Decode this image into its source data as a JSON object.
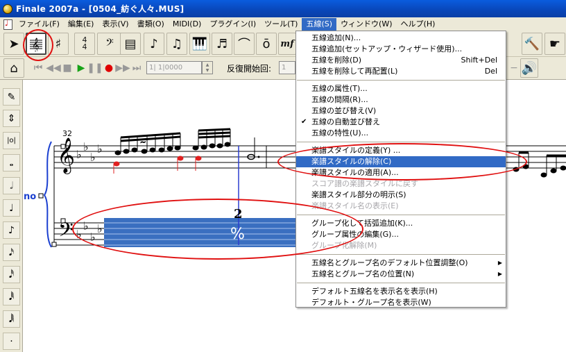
{
  "window": {
    "title": "Finale 2007a - [0504_紡ぐ人々.MUS]"
  },
  "menubar": {
    "items": [
      "ファイル(F)",
      "編集(E)",
      "表示(V)",
      "書類(O)",
      "MIDI(D)",
      "プラグイン(I)",
      "ツール(T)",
      "五線(S)",
      "ウィンドウ(W)",
      "ヘルプ(H)"
    ],
    "active": "五線(S)"
  },
  "playback": {
    "counter": "1| 1|0000",
    "repeat_label": "反復開始回:",
    "repeat_value": "1"
  },
  "score": {
    "measure_number": "32",
    "rest_count": "2",
    "staff_label": "no"
  },
  "dropdown": {
    "items": [
      {
        "label": "五線追加(N)...",
        "shortcut": ""
      },
      {
        "label": "五線追加(セットアップ・ウィザード使用)...",
        "shortcut": ""
      },
      {
        "label": "五線を削除(D)",
        "shortcut": "Shift+Del"
      },
      {
        "label": "五線を削除して再配置(L)",
        "shortcut": "Del"
      },
      {
        "separator": true
      },
      {
        "label": "五線の属性(T)...",
        "shortcut": ""
      },
      {
        "label": "五線の間隔(R)...",
        "shortcut": ""
      },
      {
        "label": "五線の並び替え(V)",
        "shortcut": ""
      },
      {
        "label": "五線の自動並び替え",
        "shortcut": "",
        "checked": true
      },
      {
        "label": "五線の特性(U)...",
        "shortcut": ""
      },
      {
        "separator": true
      },
      {
        "label": "楽譜スタイルの定義(Y) ...",
        "shortcut": ""
      },
      {
        "label": "楽譜スタイルの解除(C)",
        "shortcut": "",
        "highlighted": true
      },
      {
        "label": "楽譜スタイルの適用(A)...",
        "shortcut": ""
      },
      {
        "label": "スコア譜の楽譜スタイルに戻す",
        "shortcut": "",
        "disabled": true
      },
      {
        "label": "楽譜スタイル部分の明示(S)",
        "shortcut": ""
      },
      {
        "label": "楽譜スタイル名の表示(E)",
        "shortcut": "",
        "disabled": true
      },
      {
        "separator": true
      },
      {
        "label": "グループ化して括弧追加(K)...",
        "shortcut": ""
      },
      {
        "label": "グループ属性の編集(G)...",
        "shortcut": ""
      },
      {
        "label": "グループ化解除(M)",
        "shortcut": "",
        "disabled": true
      },
      {
        "separator": true
      },
      {
        "label": "五線名とグループ名のデフォルト位置調整(O)",
        "shortcut": "",
        "submenu": true
      },
      {
        "label": "五線名とグループ名の位置(N)",
        "shortcut": "",
        "submenu": true
      },
      {
        "separator": true
      },
      {
        "label": "デフォルト五線名を表示名を表示(H)",
        "shortcut": ""
      },
      {
        "label": "デフォルト・グループ名を表示(W)",
        "shortcut": ""
      }
    ]
  },
  "colors": {
    "titlebar": "#0a4fc9",
    "menu_highlight": "#316ac5",
    "annotation": "#e01010",
    "selection": "#3a6fc0",
    "note_red": "#e02020"
  }
}
